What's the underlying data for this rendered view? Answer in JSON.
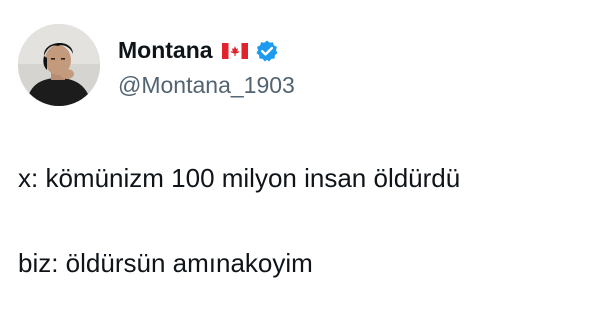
{
  "author": {
    "display_name": "Montana",
    "handle": "@Montana_1903",
    "flag_icon": "canada-flag-icon",
    "verified_icon": "verified-badge-icon",
    "verified_color": "#1d9bf0"
  },
  "tweet": {
    "lines": [
      "x: kömünizm 100 milyon insan öldürdü",
      "biz: öldürsün amınakoyim"
    ]
  },
  "colors": {
    "text": "#0f1419",
    "handle": "#536471",
    "background": "#ffffff"
  }
}
